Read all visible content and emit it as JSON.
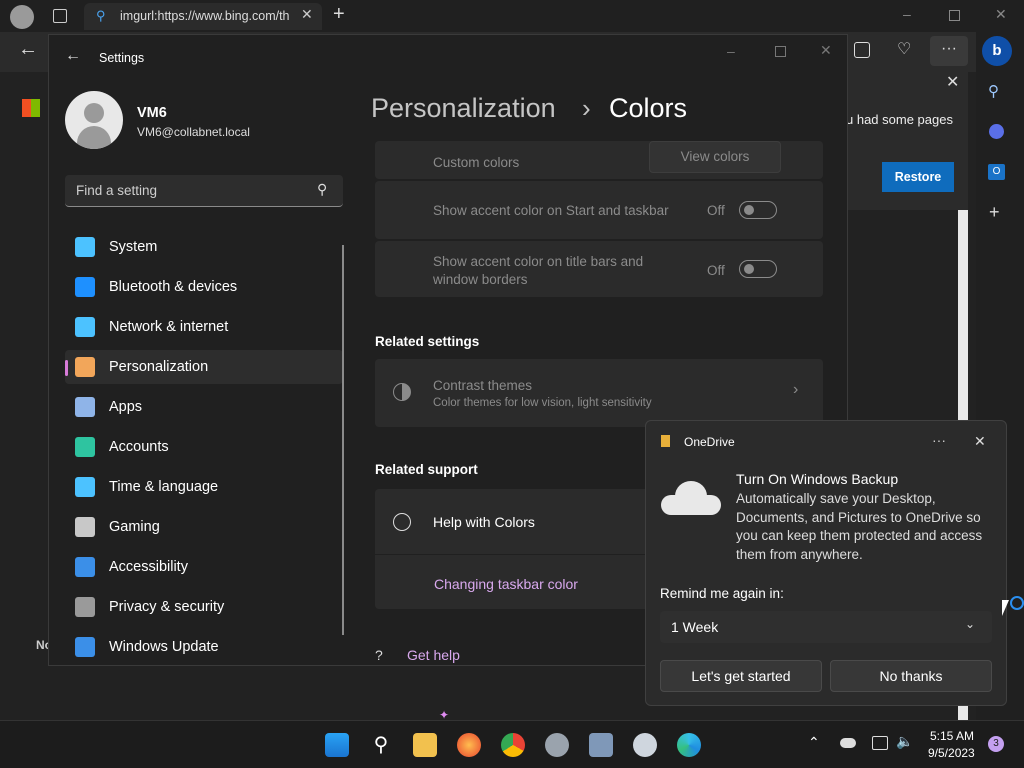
{
  "browser": {
    "tab_title": "imgurl:https://www.bing.com/th",
    "infobar_text": "u had some pages",
    "restore_label": "Restore",
    "bg_partial_text": "No"
  },
  "settings": {
    "title": "Settings",
    "user": {
      "name": "VM6",
      "email": "VM6@collabnet.local"
    },
    "search_placeholder": "Find a setting",
    "nav": [
      {
        "label": "System",
        "icon": "system-icon",
        "color": "#4cc2ff"
      },
      {
        "label": "Bluetooth & devices",
        "icon": "bluetooth-icon",
        "color": "#1e90ff"
      },
      {
        "label": "Network & internet",
        "icon": "wifi-icon",
        "color": "#4cc2ff"
      },
      {
        "label": "Personalization",
        "icon": "brush-icon",
        "color": "#f2a65a"
      },
      {
        "label": "Apps",
        "icon": "apps-icon",
        "color": "#8fb4e8"
      },
      {
        "label": "Accounts",
        "icon": "accounts-icon",
        "color": "#2ec4a0"
      },
      {
        "label": "Time & language",
        "icon": "globe-clock-icon",
        "color": "#4cc2ff"
      },
      {
        "label": "Gaming",
        "icon": "gamepad-icon",
        "color": "#c8c8c8"
      },
      {
        "label": "Accessibility",
        "icon": "accessibility-icon",
        "color": "#3b8fe8"
      },
      {
        "label": "Privacy & security",
        "icon": "shield-icon",
        "color": "#9a9a9a"
      },
      {
        "label": "Windows Update",
        "icon": "update-icon",
        "color": "#3b8fe8"
      }
    ],
    "breadcrumb": {
      "parent": "Personalization",
      "sep": "›",
      "current": "Colors"
    },
    "custom_colors_label": "Custom colors",
    "view_colors_label": "View colors",
    "accent_start_label": "Show accent color on Start and taskbar",
    "accent_start_state": "Off",
    "accent_title_label": "Show accent color on title bars and window borders",
    "accent_title_state": "Off",
    "related_settings_heading": "Related settings",
    "contrast_title": "Contrast themes",
    "contrast_sub": "Color themes for low vision, light sensitivity",
    "related_support_heading": "Related support",
    "help_label": "Help with Colors",
    "changing_taskbar_label": "Changing taskbar color",
    "get_help_label": "Get help"
  },
  "onedrive": {
    "app_name": "OneDrive",
    "title": "Turn On Windows Backup",
    "body": "Automatically save your Desktop, Documents, and Pictures to OneDrive so you can keep them protected and access them from anywhere.",
    "remind_label": "Remind me again in:",
    "remind_value": "1 Week",
    "primary_button": "Let's get started",
    "secondary_button": "No thanks"
  },
  "taskbar": {
    "time": "5:15 AM",
    "date": "9/5/2023",
    "notification_count": "3",
    "accent": "#0078d4"
  }
}
